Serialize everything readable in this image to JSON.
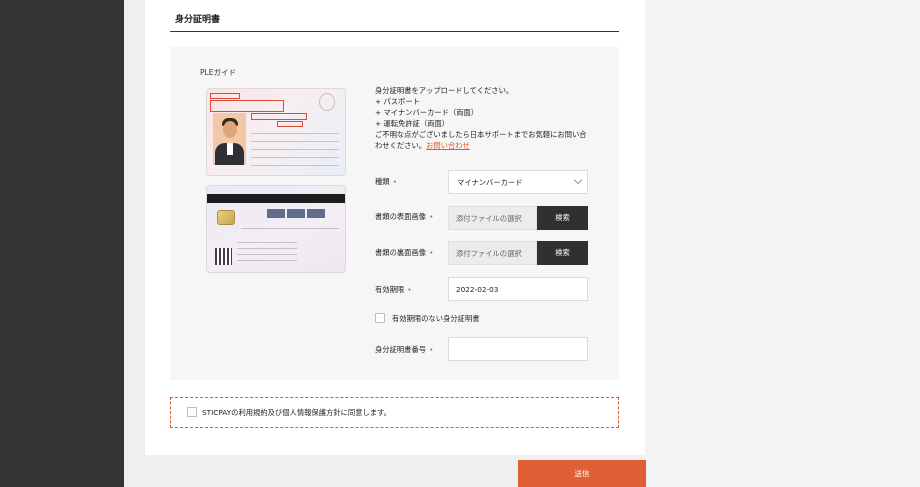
{
  "section": {
    "title": "身分証明書"
  },
  "guide": {
    "label": "PLEガイド"
  },
  "instructions": {
    "line1": "身分証明書をアップロードしてください。",
    "line2": "+ パスポート",
    "line3": "+ マイナンバーカード（両面）",
    "line4": "+ 運転免許証（両面）",
    "line5": "ご不明な点がございましたら日本サポートまでお気軽にお問い合",
    "line6_prefix": "わせください。",
    "contact_link": "お問い合わせ"
  },
  "form": {
    "type": {
      "label": "種類",
      "value": "マイナンバーカード"
    },
    "front_image": {
      "label": "書類の表面画像",
      "placeholder": "添付ファイルの選択",
      "button": "検索"
    },
    "back_image": {
      "label": "書類の裏面画像",
      "placeholder": "添付ファイルの選択",
      "button": "検索"
    },
    "expiry": {
      "label": "有効期限",
      "value": "2022-02-03"
    },
    "no_expiry": {
      "label": "有効期限のない身分証明書"
    },
    "id_number": {
      "label": "身分証明書番号",
      "value": ""
    },
    "required_mark": "•"
  },
  "agreement": {
    "text": "STICPAYの利用規約及び個人情報保護方針に同意します。"
  },
  "submit": {
    "label": "送信"
  },
  "colors": {
    "accent": "#e35b2a",
    "dark_button": "#303030",
    "sidebar": "#333333"
  }
}
